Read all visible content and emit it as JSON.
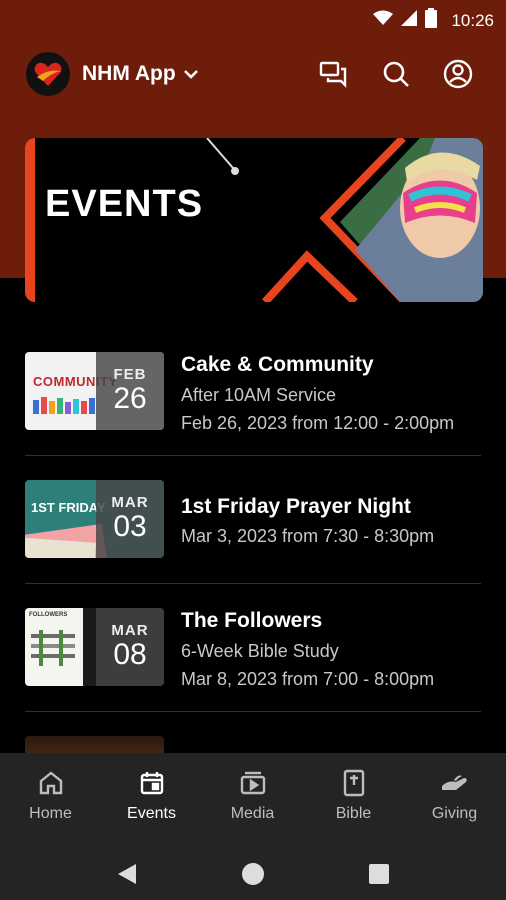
{
  "status_bar": {
    "time": "10:26"
  },
  "header": {
    "app_title": "NHM App"
  },
  "banner": {
    "title": "EVENTS"
  },
  "events": [
    {
      "title": "Cake & Community",
      "subtitle": "After 10AM Service",
      "when": "Feb 26, 2023 from 12:00 - 2:00pm",
      "month": "FEB",
      "day": "26",
      "thumb_text": "COMMUNITY"
    },
    {
      "title": "1st Friday Prayer Night",
      "subtitle": "",
      "when": "Mar 3, 2023 from 7:30 - 8:30pm",
      "month": "MAR",
      "day": "03",
      "thumb_text": "1ST FRIDAY"
    },
    {
      "title": "The Followers",
      "subtitle": "6-Week Bible Study",
      "when": "Mar 8, 2023 from 7:00 - 8:00pm",
      "month": "MAR",
      "day": "08",
      "thumb_text": "FOLLOWERS"
    }
  ],
  "bottom_nav": [
    {
      "label": "Home",
      "icon": "home-icon",
      "active": false
    },
    {
      "label": "Events",
      "icon": "calendar-icon",
      "active": true
    },
    {
      "label": "Media",
      "icon": "media-icon",
      "active": false
    },
    {
      "label": "Bible",
      "icon": "bible-icon",
      "active": false
    },
    {
      "label": "Giving",
      "icon": "giving-icon",
      "active": false
    }
  ],
  "colors": {
    "header_bg": "#6e1d0b",
    "accent": "#e8451e",
    "nav_bg": "#242424"
  }
}
